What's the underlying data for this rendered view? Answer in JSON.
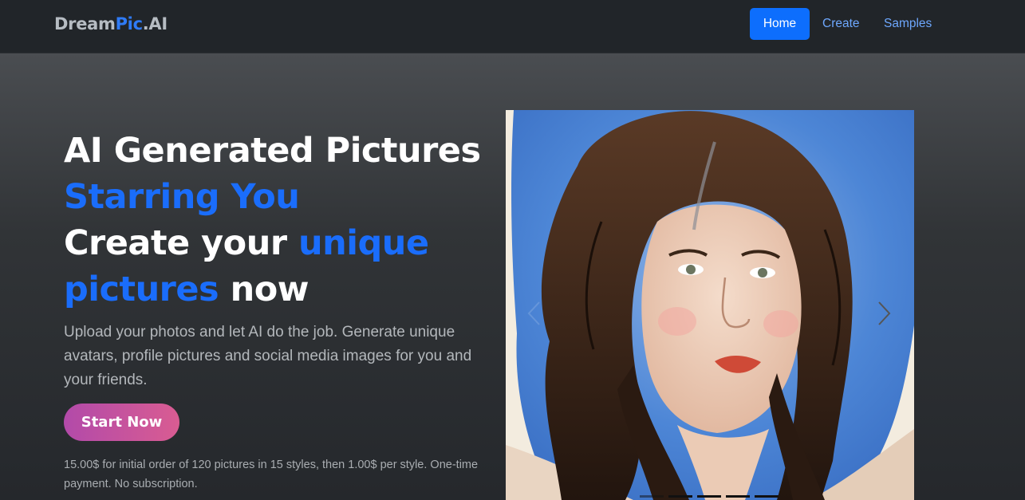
{
  "brand": {
    "part1": "Dream",
    "part2": "Pic",
    "part3": ".AI"
  },
  "nav": {
    "home": "Home",
    "create": "Create",
    "samples": "Samples"
  },
  "hero": {
    "line1": "AI Generated Pictures",
    "line2": "Starring You",
    "line3a": "Create your ",
    "line3b": "unique",
    "line4a": "pictures",
    "line4b": " now",
    "lead": "Upload your photos and let AI do the job. Generate unique avatars, profile pictures and social media images for you and your friends.",
    "cta": "Start Now",
    "pricing": "15.00$ for initial order of 120 pictures in 15 styles, then 1.00$ per style. One-time payment. No subscription."
  },
  "carousel": {
    "slide_count": 5,
    "active_index": 0
  },
  "colors": {
    "accent": "#0d6efd",
    "cta_start": "#b24aa9",
    "cta_end": "#d95c92"
  }
}
